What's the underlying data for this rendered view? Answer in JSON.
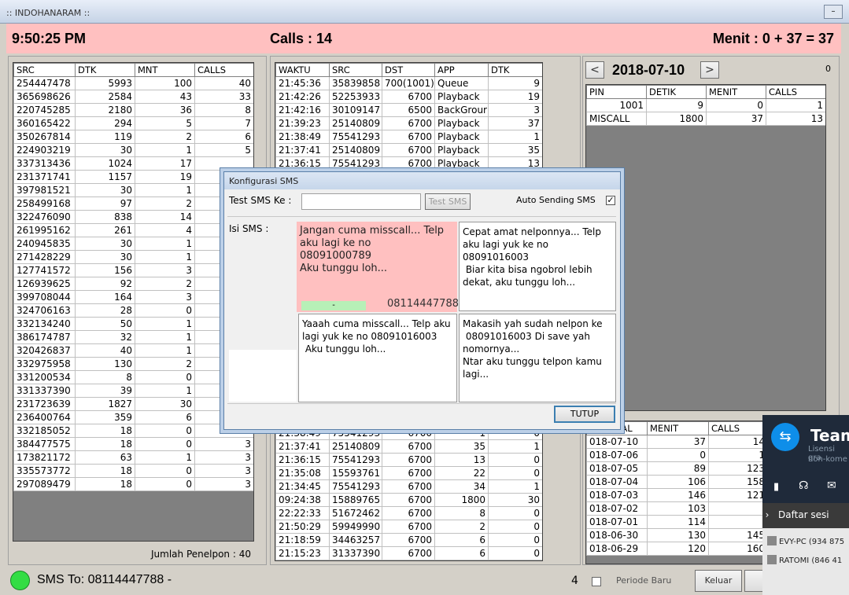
{
  "window": {
    "title": ":: INDOHANARAM ::",
    "min_label": "–"
  },
  "header": {
    "time": "9:50:25 PM",
    "calls": "Calls : 14",
    "menit": "Menit : 0 + 37 = 37"
  },
  "src_table": {
    "headers": [
      "SRC",
      "DTK",
      "MNT",
      "CALLS"
    ],
    "rows": [
      [
        "254447478",
        "5993",
        "100",
        "40"
      ],
      [
        "365698626",
        "2584",
        "43",
        "33"
      ],
      [
        "220745285",
        "2180",
        "36",
        "8"
      ],
      [
        "360165422",
        "294",
        "5",
        "7"
      ],
      [
        "350267814",
        "119",
        "2",
        "6"
      ],
      [
        "224903219",
        "30",
        "1",
        "5"
      ],
      [
        "337313436",
        "1024",
        "17",
        ""
      ],
      [
        "231371741",
        "1157",
        "19",
        ""
      ],
      [
        "397981521",
        "30",
        "1",
        ""
      ],
      [
        "258499168",
        "97",
        "2",
        ""
      ],
      [
        "322476090",
        "838",
        "14",
        ""
      ],
      [
        "261995162",
        "261",
        "4",
        ""
      ],
      [
        "240945835",
        "30",
        "1",
        ""
      ],
      [
        "271428229",
        "30",
        "1",
        ""
      ],
      [
        "127741572",
        "156",
        "3",
        ""
      ],
      [
        "126939625",
        "92",
        "2",
        ""
      ],
      [
        "399708044",
        "164",
        "3",
        ""
      ],
      [
        "324706163",
        "28",
        "0",
        ""
      ],
      [
        "332134240",
        "50",
        "1",
        ""
      ],
      [
        "386174787",
        "32",
        "1",
        ""
      ],
      [
        "320426837",
        "40",
        "1",
        ""
      ],
      [
        "332975958",
        "130",
        "2",
        ""
      ],
      [
        "331200534",
        "8",
        "0",
        ""
      ],
      [
        "331337390",
        "39",
        "1",
        ""
      ],
      [
        "231723639",
        "1827",
        "30",
        "4"
      ],
      [
        "236400764",
        "359",
        "6",
        "3"
      ],
      [
        "332185052",
        "18",
        "0",
        "3"
      ],
      [
        "384477575",
        "18",
        "0",
        "3"
      ],
      [
        "173821172",
        "63",
        "1",
        "3"
      ],
      [
        "335573772",
        "18",
        "0",
        "3"
      ],
      [
        "297089479",
        "18",
        "0",
        "3"
      ]
    ],
    "footer": "Jumlah Penelpon : 40"
  },
  "log_table": {
    "headers": [
      "WAKTU",
      "SRC",
      "DST",
      "APP",
      "DTK"
    ],
    "rows_top": [
      [
        "21:45:36",
        "35839858",
        "700(1001)",
        "Queue",
        "9"
      ],
      [
        "21:42:26",
        "52253933",
        "6700",
        "Playback",
        "19"
      ],
      [
        "21:42:16",
        "30109147",
        "6500",
        "BackGrour",
        "3"
      ],
      [
        "21:39:23",
        "25140809",
        "6700",
        "Playback",
        "37"
      ],
      [
        "21:38:49",
        "75541293",
        "6700",
        "Playback",
        "1"
      ],
      [
        "21:37:41",
        "25140809",
        "6700",
        "Playback",
        "35"
      ],
      [
        "21:36:15",
        "75541293",
        "6700",
        "Playback",
        "13"
      ]
    ],
    "rows_bottom": [
      [
        "21:38:49",
        "75541293",
        "6700",
        "1",
        "0"
      ],
      [
        "21:37:41",
        "25140809",
        "6700",
        "35",
        "1"
      ],
      [
        "21:36:15",
        "75541293",
        "6700",
        "13",
        "0"
      ],
      [
        "21:35:08",
        "15593761",
        "6700",
        "22",
        "0"
      ],
      [
        "21:34:45",
        "75541293",
        "6700",
        "34",
        "1"
      ],
      [
        "09:24:38",
        "15889765",
        "6700",
        "1800",
        "30"
      ],
      [
        "22:22:33",
        "51672462",
        "6700",
        "8",
        "0"
      ],
      [
        "21:50:29",
        "59949990",
        "6700",
        "2",
        "0"
      ],
      [
        "21:18:59",
        "34463257",
        "6700",
        "6",
        "0"
      ],
      [
        "21:15:23",
        "31337390",
        "6700",
        "6",
        "0"
      ]
    ]
  },
  "date_nav": {
    "prev": "<",
    "date": "2018-07-10",
    "next": ">",
    "counter": "0"
  },
  "pin_table": {
    "headers": [
      "PIN",
      "DETIK",
      "MENIT",
      "CALLS"
    ],
    "rows": [
      [
        "1001",
        "9",
        "0",
        "1"
      ],
      [
        "MISCALL",
        "1800",
        "37",
        "13"
      ]
    ]
  },
  "daily_table": {
    "headers": [
      "TANGGAL",
      "MENIT",
      "CALLS"
    ],
    "rows": [
      [
        "018-07-10",
        "37",
        "14"
      ],
      [
        "018-07-06",
        "0",
        "1"
      ],
      [
        "018-07-05",
        "89",
        "123"
      ],
      [
        "018-07-04",
        "106",
        "158"
      ],
      [
        "018-07-03",
        "146",
        "121"
      ],
      [
        "018-07-02",
        "103",
        ""
      ],
      [
        "018-07-01",
        "114",
        ""
      ],
      [
        "018-06-30",
        "130",
        "145"
      ],
      [
        "018-06-29",
        "120",
        "160"
      ]
    ]
  },
  "dialog": {
    "title": "Konfigurasi SMS",
    "test_label": "Test SMS Ke :",
    "test_value": "",
    "test_button": "Test SMS",
    "auto_label": "Auto Sending SMS",
    "isi_label": "Isi SMS :",
    "sms1": "Jangan cuma misscall... Telp\naku lagi ke no\n08091000789\nAku tunggu loh...",
    "sms1_bar": "-",
    "sms1_number": "08114447788",
    "sms2": "Cepat amat nelponnya... Telp\naku lagi yuk ke no 08091016003\n Biar kita bisa ngobrol lebih\ndekat, aku tunggu loh...",
    "sms3": "Yaaah cuma misscall... Telp aku\nlagi yuk ke no 08091016003\n Aku tunggu loh...",
    "sms4": "Makasih yah sudah nelpon ke\n 08091016003 Di save yah\nnomornya...\nNtar aku tunggu telpon kamu\nlagi...",
    "close_button": "TUTUP"
  },
  "status": {
    "sms_to": "SMS To: 08114447788 -",
    "count": "4",
    "periode": "Periode Baru",
    "keluar": "Keluar"
  },
  "teamviewer": {
    "title": "Team",
    "sub1": "Lisensi gra",
    "sub2": "non-kome",
    "section": "Daftar sesi",
    "sessions": [
      "EVY-PC (934 875",
      "RATOMI (846 41"
    ]
  },
  "colors": {
    "header_bg": "#ffc0c0",
    "sms_selected_bg": "#ffc0c0",
    "status_led": "#33dd44",
    "teamviewer_bg": "#1f2a3a",
    "teamviewer_accent": "#0e8ee9"
  }
}
